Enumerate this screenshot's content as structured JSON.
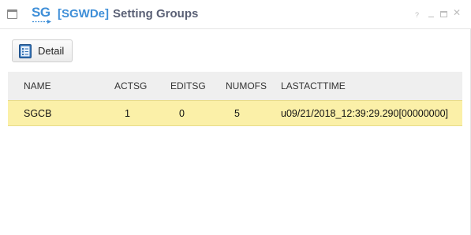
{
  "window": {
    "logo_text": "SG",
    "title_code": "[SGWDe]",
    "title_name": "Setting Groups",
    "help_label": "?"
  },
  "toolbar": {
    "detail_label": "Detail"
  },
  "grid": {
    "columns": [
      "NAME",
      "ACTSG",
      "EDITSG",
      "NUMOFS",
      "LASTACTTIME"
    ],
    "rows": [
      {
        "name": "SGCB",
        "actsg": "1",
        "editsg": "0",
        "numofs": "5",
        "lastacttime": "u09/21/2018_12:39:29.290[00000000]"
      }
    ]
  },
  "colors": {
    "accent": "#3f8fd8",
    "title_text": "#5a6075",
    "selected_row": "#fbf0a8",
    "header_bg": "#efefef"
  }
}
